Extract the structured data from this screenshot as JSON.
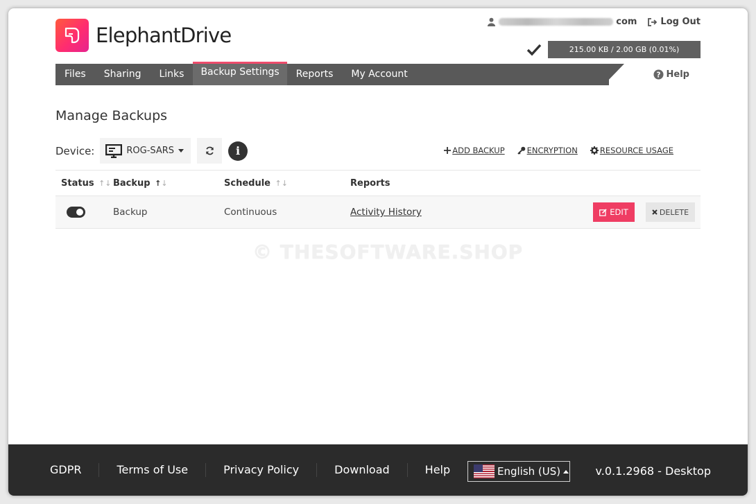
{
  "brand": {
    "name": "ElephantDrive",
    "colors": {
      "accent": "#ef3d63",
      "nav": "#595959"
    }
  },
  "user": {
    "email_suffix": "com",
    "logout_label": "Log Out"
  },
  "storage": {
    "text": "215.00 KB / 2.00 GB (0.01%)"
  },
  "nav": {
    "items": [
      {
        "label": "Files"
      },
      {
        "label": "Sharing"
      },
      {
        "label": "Links"
      },
      {
        "label": "Backup Settings"
      },
      {
        "label": "Reports"
      },
      {
        "label": "My Account"
      }
    ],
    "active": "Backup Settings",
    "help_label": "Help"
  },
  "page": {
    "title": "Manage Backups"
  },
  "device": {
    "label": "Device:",
    "selected": "ROG-SARS"
  },
  "actions": {
    "add": "ADD BACKUP",
    "encryption": "ENCRYPTION",
    "resource": "RESOURCE USAGE"
  },
  "table": {
    "headers": {
      "status": "Status",
      "backup": "Backup",
      "schedule": "Schedule",
      "reports": "Reports"
    },
    "rows": [
      {
        "status": "on",
        "backup": "Backup",
        "schedule": "Continuous",
        "report": "Activity History",
        "edit": "EDIT",
        "delete": "DELETE"
      }
    ]
  },
  "watermark": "© THESOFTWARE.SHOP",
  "footer": {
    "links": [
      "GDPR",
      "Terms of Use",
      "Privacy Policy",
      "Download",
      "Help"
    ],
    "language": "English (US)",
    "version": "v.0.1.2968 - Desktop"
  }
}
